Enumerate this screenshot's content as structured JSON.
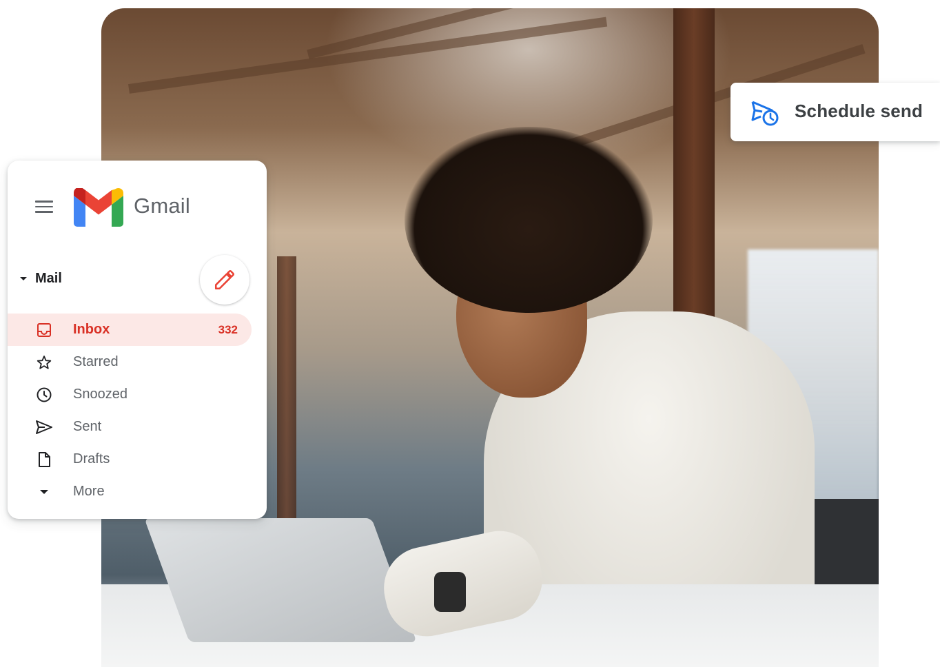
{
  "gmail": {
    "brand": "Gmail",
    "mail_section": "Mail",
    "nav": [
      {
        "label": "Inbox",
        "count": "332",
        "icon": "inbox-icon",
        "active": true
      },
      {
        "label": "Starred",
        "icon": "star-icon"
      },
      {
        "label": "Snoozed",
        "icon": "clock-icon"
      },
      {
        "label": "Sent",
        "icon": "send-icon"
      },
      {
        "label": "Drafts",
        "icon": "draft-icon"
      },
      {
        "label": "More",
        "icon": "chevron-down-icon"
      }
    ]
  },
  "schedule": {
    "label": "Schedule send",
    "icon": "schedule-send-icon"
  },
  "colors": {
    "accent_red": "#d93025",
    "active_bg": "#fce8e6",
    "schedule_blue": "#1a73e8",
    "text_gray": "#5f6368"
  }
}
